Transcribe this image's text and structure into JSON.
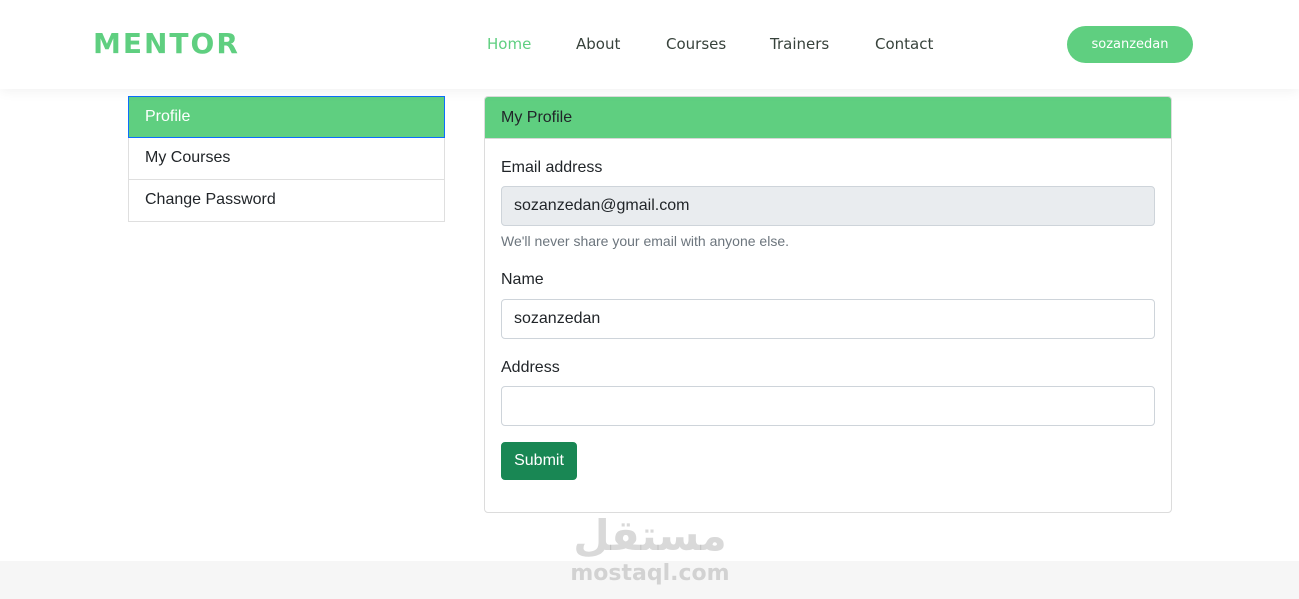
{
  "header": {
    "logo": "MENTOR",
    "nav": [
      {
        "label": "Home",
        "active": true
      },
      {
        "label": "About",
        "active": false
      },
      {
        "label": "Courses",
        "active": false
      },
      {
        "label": "Trainers",
        "active": false
      },
      {
        "label": "Contact",
        "active": false
      }
    ],
    "user_button": "sozanzedan"
  },
  "sidebar": {
    "items": [
      {
        "label": "Profile",
        "active": true
      },
      {
        "label": "My Courses",
        "active": false
      },
      {
        "label": "Change Password",
        "active": false
      }
    ]
  },
  "profile_card": {
    "title": "My Profile",
    "email_label": "Email address",
    "email_value": "sozanzedan@gmail.com",
    "email_help": "We'll never share your email with anyone else.",
    "name_label": "Name",
    "name_value": "sozanzedan",
    "address_label": "Address",
    "address_value": "",
    "submit_label": "Submit"
  },
  "watermark": {
    "arabic": "مستقل",
    "latin": "mostaql.com"
  },
  "colors": {
    "accent": "#5fcf80",
    "submit": "#198754",
    "readonly_bg": "#e9ecef"
  }
}
